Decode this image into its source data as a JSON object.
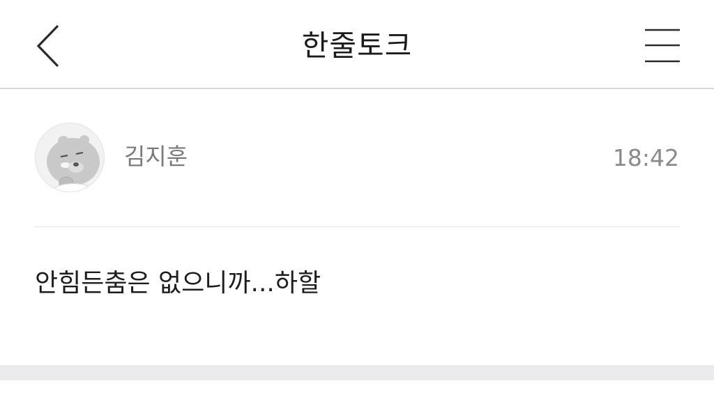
{
  "header": {
    "title": "한줄토크",
    "back_icon": "chevron-left-icon",
    "menu_icon": "hamburger-menu-icon"
  },
  "post": {
    "author": "김지훈",
    "time": "18:42",
    "message": "안힘든춤은 없으니까...하할",
    "avatar_icon": "character-avatar-icon"
  },
  "colors": {
    "header_border": "#d6d6d6",
    "divider": "#e4e4e4",
    "footer_band": "#ebebed",
    "muted_text": "#7a7a7a"
  }
}
